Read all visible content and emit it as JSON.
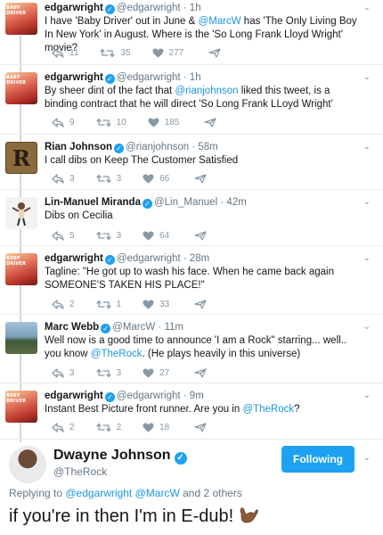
{
  "tweets": [
    {
      "name": "edgarwright",
      "handle": "@edgarwright · 1h",
      "avatar_text": "BABY DRIVER",
      "text": [
        {
          "t": "I have 'Baby Driver' out in June & "
        },
        {
          "t": "@MarcW",
          "m": true
        },
        {
          "t": " has 'The Only Living Boy In New York' in August. Where is the 'So Long Frank Lloyd Wright' movie?"
        }
      ],
      "reply": "11",
      "retweet": "35",
      "like": "277"
    },
    {
      "name": "edgarwright",
      "handle": "@edgarwright · 1h",
      "avatar_text": "BABY DRIVER",
      "text": [
        {
          "t": "By sheer dint of the fact that "
        },
        {
          "t": "@rianjohnson",
          "m": true
        },
        {
          "t": " liked this tweet, is a binding contract that he will direct 'So Long Frank LLoyd Wright'"
        }
      ],
      "reply": "9",
      "retweet": "10",
      "like": "185"
    },
    {
      "name": "Rian Johnson",
      "handle": "@rianjohnson · 58m",
      "avatar_text": "R",
      "text": [
        {
          "t": "I call dibs on Keep The Customer Satisfied"
        }
      ],
      "reply": "3",
      "retweet": "3",
      "like": "66"
    },
    {
      "name": "Lin-Manuel Miranda",
      "handle": "@Lin_Manuel · 42m",
      "avatar_text": "",
      "text": [
        {
          "t": "Dibs on Cecilia"
        }
      ],
      "reply": "5",
      "retweet": "3",
      "like": "64"
    },
    {
      "name": "edgarwright",
      "handle": "@edgarwright · 28m",
      "avatar_text": "BABY DRIVER",
      "text": [
        {
          "t": "Tagline: \"He got up to wash his face. When he came back again SOMEONE'S TAKEN HIS PLACE!\""
        }
      ],
      "reply": "2",
      "retweet": "1",
      "like": "33"
    },
    {
      "name": "Marc Webb",
      "handle": "@MarcW · 11m",
      "avatar_text": "",
      "text": [
        {
          "t": "Well now is a good time to announce 'I am a Rock\" starring... well.. you know "
        },
        {
          "t": "@TheRock",
          "m": true
        },
        {
          "t": ". (He plays heavily in this universe)"
        }
      ],
      "reply": "3",
      "retweet": "3",
      "like": "27"
    },
    {
      "name": "edgarwright",
      "handle": "@edgarwright · 9m",
      "avatar_text": "BABY DRIVER",
      "text": [
        {
          "t": "Instant Best Picture front runner. Are you in "
        },
        {
          "t": "@TheRock",
          "m": true
        },
        {
          "t": "?"
        }
      ],
      "reply": "2",
      "retweet": "2",
      "like": "18"
    }
  ],
  "main": {
    "name": "Dwayne Johnson",
    "handle": "@TheRock",
    "follow_label": "Following",
    "replying_prefix": "Replying to ",
    "replying_m1": "@edgarwright",
    "replying_m2": "@MarcW",
    "replying_suffix": " and 2 others",
    "text": "if you're in then I'm in E-dub!",
    "emoji": "call-me-hand-medium-dark-skin"
  },
  "colors": {
    "accent": "#1da1f2",
    "mention": "#1b95e0",
    "muted": "#657786",
    "icon": "#8899a6"
  }
}
